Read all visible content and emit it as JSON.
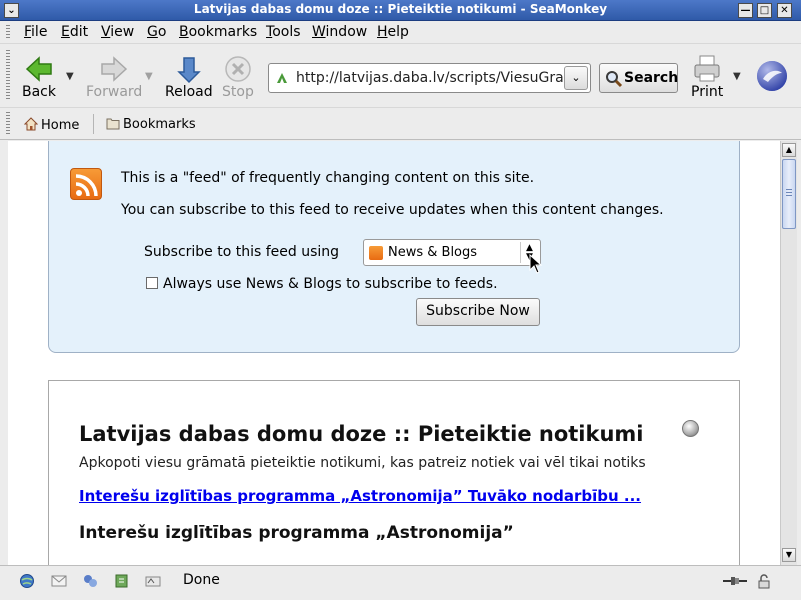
{
  "window": {
    "title": "Latvijas dabas domu doze :: Pieteiktie notikumi - SeaMonkey"
  },
  "menubar": {
    "items": [
      "File",
      "Edit",
      "View",
      "Go",
      "Bookmarks",
      "Tools",
      "Window",
      "Help"
    ]
  },
  "navbar": {
    "back_label": "Back",
    "forward_label": "Forward",
    "reload_label": "Reload",
    "stop_label": "Stop",
    "url": "http://latvijas.daba.lv/scripts/ViesuGramata.cgi",
    "search_label": "Search",
    "print_label": "Print"
  },
  "personal_bar": {
    "home_label": "Home",
    "bookmarks_label": "Bookmarks"
  },
  "feed_box": {
    "line1": "This is a \"feed\" of frequently changing content on this site.",
    "line2": "You can subscribe to this feed to receive updates when this content changes.",
    "subscribe_using_label": "Subscribe to this feed using",
    "reader_selected": "News & Blogs",
    "always_use_label": "Always use News & Blogs to subscribe to feeds.",
    "always_use_checked": false,
    "subscribe_now_label": "Subscribe Now"
  },
  "feed": {
    "title": "Latvijas dabas domu doze :: Pieteiktie notikumi",
    "subtitle": "Apkopoti viesu grāmatā pieteiktie notikumi, kas patreiz notiek vai vēl tikai notiks",
    "entry_link": "Interešu izglītības programma „Astronomija” Tuvāko nodarbību ...",
    "entry_heading": "Interešu izglītības programma „Astronomija”"
  },
  "status": {
    "text": "Done"
  }
}
